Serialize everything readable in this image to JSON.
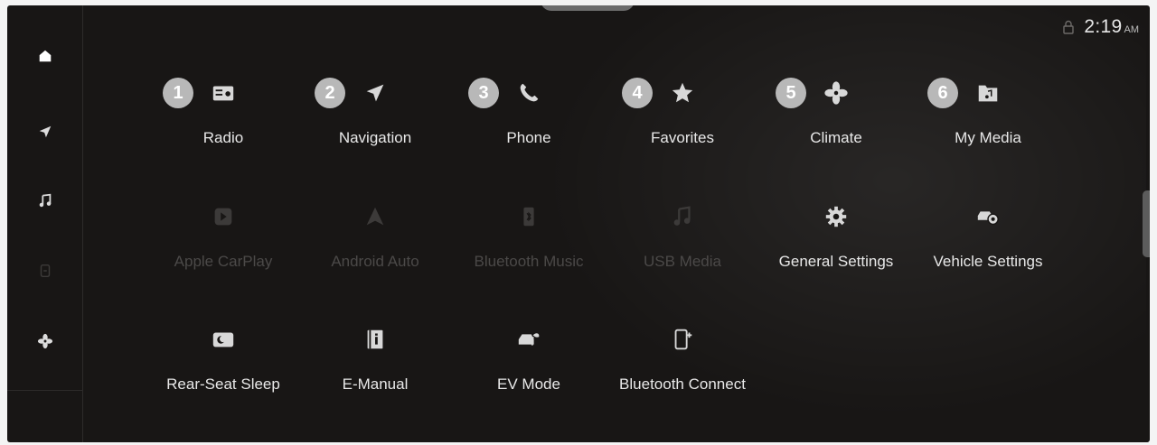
{
  "status": {
    "time": "2:19",
    "ampm": "AM"
  },
  "sidebar": {
    "items": [
      {
        "icon": "home-icon"
      },
      {
        "icon": "navigation-arrow-icon"
      },
      {
        "icon": "music-note-icon"
      },
      {
        "icon": "phone-projection-icon"
      },
      {
        "icon": "fan-icon"
      }
    ]
  },
  "menu": {
    "row1": [
      {
        "num": "1",
        "label": "Radio",
        "icon": "radio-icon"
      },
      {
        "num": "2",
        "label": "Navigation",
        "icon": "navigation-arrow-icon"
      },
      {
        "num": "3",
        "label": "Phone",
        "icon": "phone-icon"
      },
      {
        "num": "4",
        "label": "Favorites",
        "icon": "star-icon"
      },
      {
        "num": "5",
        "label": "Climate",
        "icon": "fan-icon"
      },
      {
        "num": "6",
        "label": "My Media",
        "icon": "media-folder-icon"
      }
    ],
    "row2": [
      {
        "label": "Apple CarPlay",
        "icon": "carplay-icon",
        "enabled": false
      },
      {
        "label": "Android Auto",
        "icon": "android-auto-icon",
        "enabled": false
      },
      {
        "label": "Bluetooth Music",
        "icon": "bluetooth-music-icon",
        "enabled": false
      },
      {
        "label": "USB Media",
        "icon": "usb-music-icon",
        "enabled": false
      },
      {
        "label": "General Settings",
        "icon": "gear-icon",
        "enabled": true
      },
      {
        "label": "Vehicle Settings",
        "icon": "vehicle-settings-icon",
        "enabled": true
      }
    ],
    "row3": [
      {
        "label": "Rear-Seat Sleep",
        "icon": "rear-seat-sleep-icon"
      },
      {
        "label": "E-Manual",
        "icon": "manual-icon"
      },
      {
        "label": "EV Mode",
        "icon": "ev-mode-icon"
      },
      {
        "label": "Bluetooth Connect",
        "icon": "bluetooth-connect-icon"
      }
    ]
  },
  "colors": {
    "background": "#181615",
    "text": "#e8e8e8",
    "disabled": "#4b4948",
    "badge": "#b8b8b8"
  }
}
